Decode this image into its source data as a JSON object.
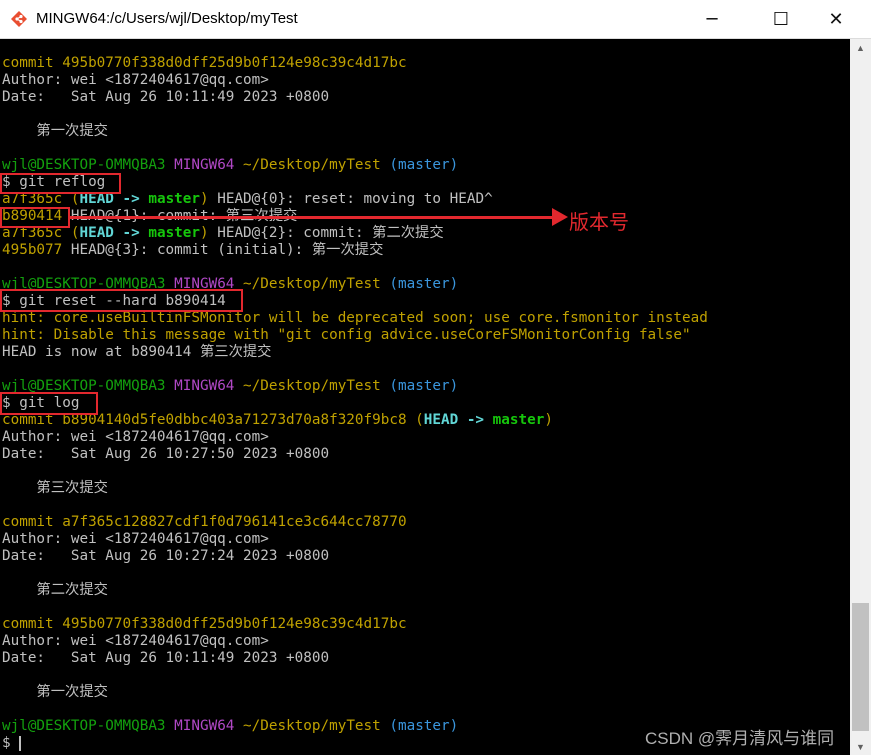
{
  "window": {
    "title": "MINGW64:/c/Users/wjl/Desktop/myTest",
    "minimize": "─",
    "maximize": "☐",
    "close": "✕"
  },
  "annotation": {
    "label": "版本号"
  },
  "watermark": "CSDN @霁月清风与谁同",
  "terminal": {
    "colors": {
      "background": "#000000",
      "hash": "#bfa100",
      "prompt_user": "#13a10e",
      "prompt_env": "#b148c6",
      "prompt_branch": "#3a96dd",
      "annotation": "#e2282e"
    },
    "lines": [
      [
        [
          "commit 495b0770f338d0dff25d9b0f124e98c39c4d17bc",
          "y"
        ]
      ],
      [
        [
          "Author: wei <1872404617@qq.com>",
          "w"
        ]
      ],
      [
        [
          "Date:   Sat Aug 26 10:11:49 2023 +0800",
          "w"
        ]
      ],
      [],
      [
        [
          "    第一次提交",
          "w"
        ]
      ],
      [],
      [
        [
          "wjl@DESKTOP-OMMQBA3 ",
          "g"
        ],
        [
          "MINGW64 ",
          "m"
        ],
        [
          "~/Desktop/myTest",
          "y"
        ],
        [
          " (master)",
          "c"
        ]
      ],
      [
        [
          "$ git reflog",
          "w"
        ]
      ],
      [
        [
          "a7f365c ",
          "y"
        ],
        [
          "(",
          "y"
        ],
        [
          "HEAD -> ",
          "bc"
        ],
        [
          "master",
          "bg"
        ],
        [
          ")",
          "y"
        ],
        [
          " HEAD@{0}: reset: moving to HEAD^",
          "w"
        ]
      ],
      [
        [
          "b890414",
          "y"
        ],
        [
          " HEAD@{1}: commit: 第三次提交",
          "w"
        ]
      ],
      [
        [
          "a7f365c ",
          "y"
        ],
        [
          "(",
          "y"
        ],
        [
          "HEAD -> ",
          "bc"
        ],
        [
          "master",
          "bg"
        ],
        [
          ")",
          "y"
        ],
        [
          " HEAD@{2}: commit: 第二次提交",
          "w"
        ]
      ],
      [
        [
          "495b077",
          "y"
        ],
        [
          " HEAD@{3}: commit (initial): 第一次提交",
          "w"
        ]
      ],
      [],
      [
        [
          "wjl@DESKTOP-OMMQBA3 ",
          "g"
        ],
        [
          "MINGW64 ",
          "m"
        ],
        [
          "~/Desktop/myTest",
          "y"
        ],
        [
          " (master)",
          "c"
        ]
      ],
      [
        [
          "$ git reset --hard b890414",
          "w"
        ]
      ],
      [
        [
          "hint: core.useBuiltinFSMonitor will be deprecated soon; use core.fsmonitor instead",
          "y"
        ]
      ],
      [
        [
          "hint: Disable this message with \"git config advice.useCoreFSMonitorConfig false\"",
          "y"
        ]
      ],
      [
        [
          "HEAD is now at b890414 第三次提交",
          "w"
        ]
      ],
      [],
      [
        [
          "wjl@DESKTOP-OMMQBA3 ",
          "g"
        ],
        [
          "MINGW64 ",
          "m"
        ],
        [
          "~/Desktop/myTest",
          "y"
        ],
        [
          " (master)",
          "c"
        ]
      ],
      [
        [
          "$ git log",
          "w"
        ]
      ],
      [
        [
          "commit b8904140d5fe0dbbc403a71273d70a8f320f9bc8 ",
          "y"
        ],
        [
          "(",
          "y"
        ],
        [
          "HEAD -> ",
          "bc"
        ],
        [
          "master",
          "bg"
        ],
        [
          ")",
          "y"
        ]
      ],
      [
        [
          "Author: wei <1872404617@qq.com>",
          "w"
        ]
      ],
      [
        [
          "Date:   Sat Aug 26 10:27:50 2023 +0800",
          "w"
        ]
      ],
      [],
      [
        [
          "    第三次提交",
          "w"
        ]
      ],
      [],
      [
        [
          "commit a7f365c128827cdf1f0d796141ce3c644cc78770",
          "y"
        ]
      ],
      [
        [
          "Author: wei <1872404617@qq.com>",
          "w"
        ]
      ],
      [
        [
          "Date:   Sat Aug 26 10:27:24 2023 +0800",
          "w"
        ]
      ],
      [],
      [
        [
          "    第二次提交",
          "w"
        ]
      ],
      [],
      [
        [
          "commit 495b0770f338d0dff25d9b0f124e98c39c4d17bc",
          "y"
        ]
      ],
      [
        [
          "Author: wei <1872404617@qq.com>",
          "w"
        ]
      ],
      [
        [
          "Date:   Sat Aug 26 10:11:49 2023 +0800",
          "w"
        ]
      ],
      [],
      [
        [
          "    第一次提交",
          "w"
        ]
      ],
      [],
      [
        [
          "wjl@DESKTOP-OMMQBA3 ",
          "g"
        ],
        [
          "MINGW64 ",
          "m"
        ],
        [
          "~/Desktop/myTest",
          "y"
        ],
        [
          " (master)",
          "c"
        ]
      ],
      [
        [
          "$ ",
          "w"
        ]
      ]
    ]
  }
}
